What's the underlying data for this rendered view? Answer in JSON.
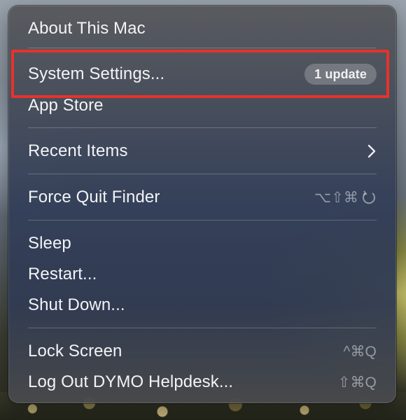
{
  "menu": {
    "about": "About This Mac",
    "system_settings": "System Settings...",
    "update_badge": "1 update",
    "app_store": "App Store",
    "recent_items": "Recent Items",
    "force_quit": "Force Quit Finder",
    "force_quit_shortcut": "⌥⇧⌘",
    "sleep": "Sleep",
    "restart": "Restart...",
    "shut_down": "Shut Down...",
    "lock_screen": "Lock Screen",
    "lock_screen_shortcut": "^⌘Q",
    "log_out": "Log Out DYMO Helpdesk...",
    "log_out_shortcut": "⇧⌘Q"
  },
  "icons": {
    "submenu_chevron": "chevron-right-icon",
    "escape_key": "escape-key-icon"
  },
  "colors": {
    "highlight_border": "#e8322b",
    "text": "#f2f3f5",
    "shortcut_text": "#9ea4ad"
  }
}
